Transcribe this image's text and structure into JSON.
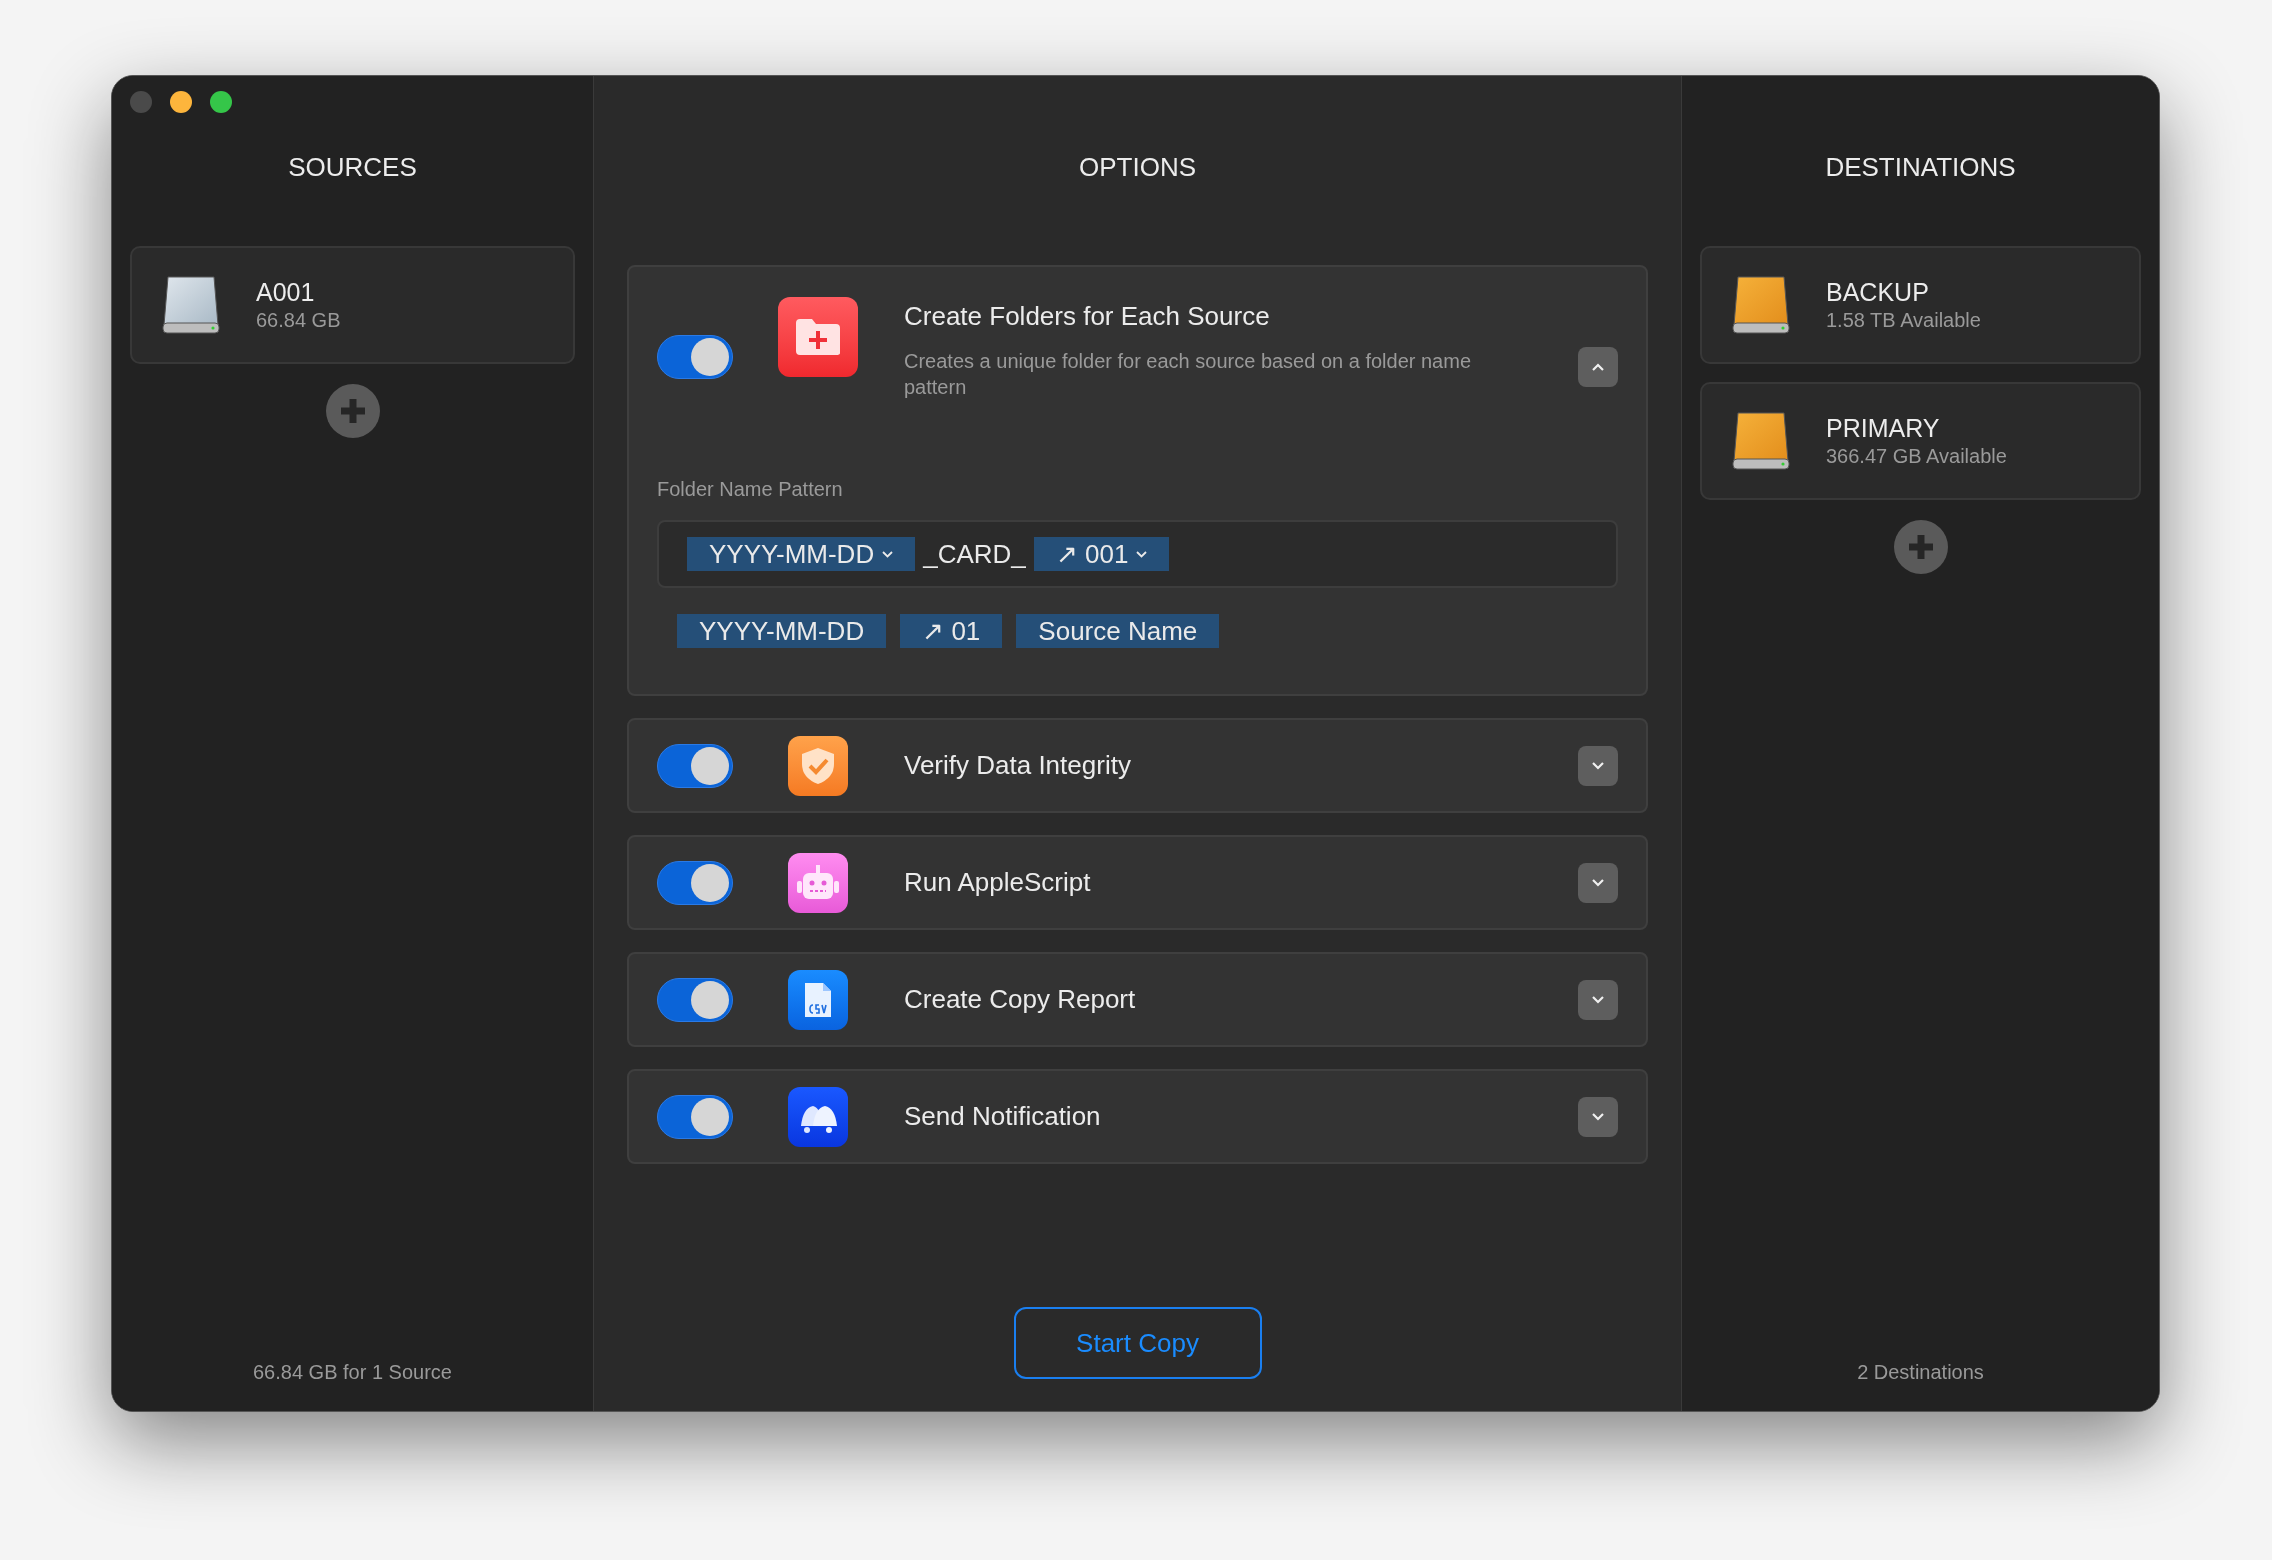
{
  "window": {
    "controls": [
      {
        "color": "#4a4a4a"
      },
      {
        "color": "#fdb53c"
      },
      {
        "color": "#35c649"
      }
    ]
  },
  "sources": {
    "title": "SOURCES",
    "items": [
      {
        "name": "A001",
        "detail": "66.84 GB",
        "kind": "silver"
      }
    ],
    "footer": "66.84 GB for 1 Source"
  },
  "options": {
    "title": "OPTIONS",
    "items": [
      {
        "title": "Create Folders for Each Source",
        "kind": "folder",
        "on": true,
        "expanded": true,
        "description": "Creates a unique folder for each source based on a folder name pattern",
        "pattern": {
          "label": "Folder Name Pattern",
          "tokens": [
            {
              "kind": "token",
              "text": "YYYY-MM-DD",
              "dropdown": true
            },
            {
              "kind": "text",
              "text": "_CARD_"
            },
            {
              "kind": "token",
              "text": "↗ 001",
              "dropdown": true
            }
          ],
          "available": [
            "YYYY-MM-DD",
            "↗ 01",
            "Source Name"
          ]
        }
      },
      {
        "title": "Verify Data Integrity",
        "kind": "shield",
        "on": true,
        "expanded": false
      },
      {
        "title": "Run AppleScript",
        "kind": "robot",
        "on": true,
        "expanded": false
      },
      {
        "title": "Create Copy Report",
        "kind": "csv",
        "on": true,
        "expanded": false
      },
      {
        "title": "Send Notification",
        "kind": "bells",
        "on": true,
        "expanded": false
      }
    ],
    "button": "Start Copy"
  },
  "destinations": {
    "title": "DESTINATIONS",
    "items": [
      {
        "name": "BACKUP",
        "detail": "1.58 TB Available",
        "kind": "orange"
      },
      {
        "name": "PRIMARY",
        "detail": "366.47 GB Available",
        "kind": "orange"
      }
    ],
    "footer": "2 Destinations"
  }
}
